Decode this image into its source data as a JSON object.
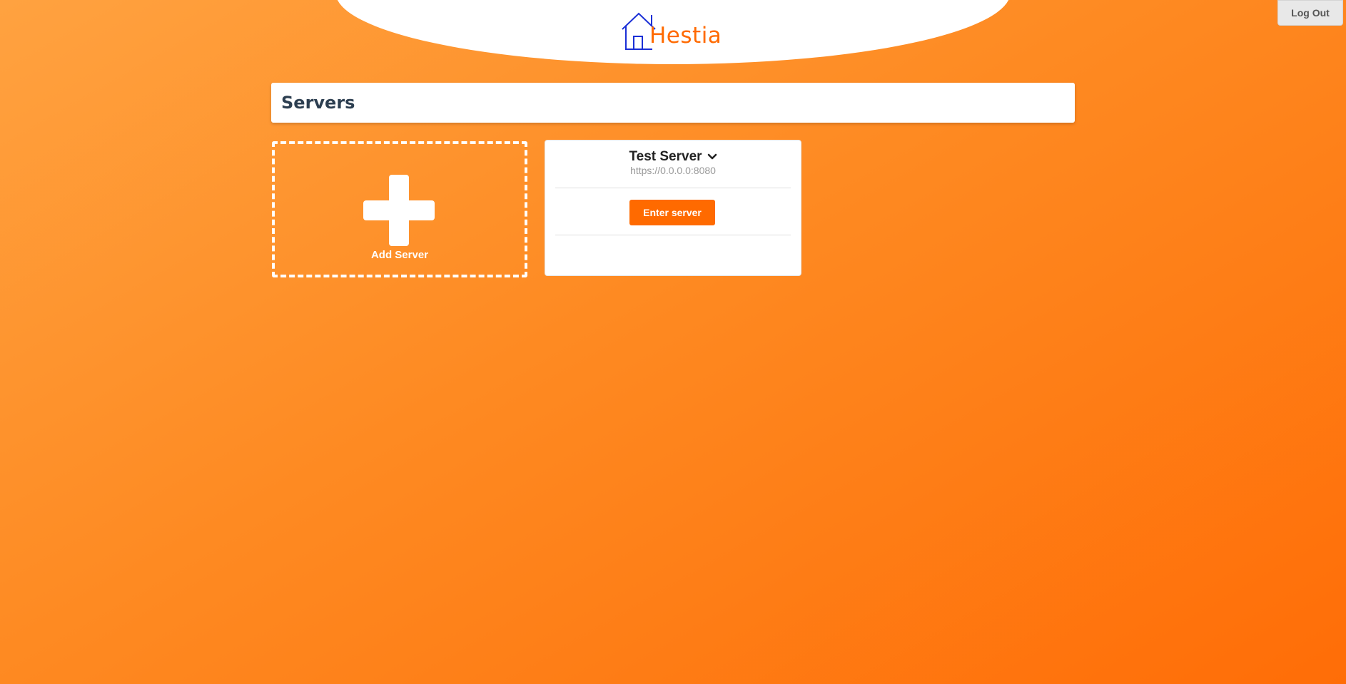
{
  "header": {
    "logo_text": "Hestia",
    "logout_label": "Log Out"
  },
  "page": {
    "title": "Servers"
  },
  "add_server": {
    "label": "Add Server",
    "icon": "plus-icon"
  },
  "servers": [
    {
      "name": "Test Server",
      "url": "https://0.0.0.0:8080",
      "enter_label": "Enter server",
      "menu_icon": "chevron-down-icon"
    }
  ],
  "colors": {
    "brand_orange": "#ff6a00",
    "logo_blue": "#1a2fd6",
    "title_text": "#2c3e50",
    "background_start": "#ffa240",
    "background_end": "#ff6d07"
  }
}
